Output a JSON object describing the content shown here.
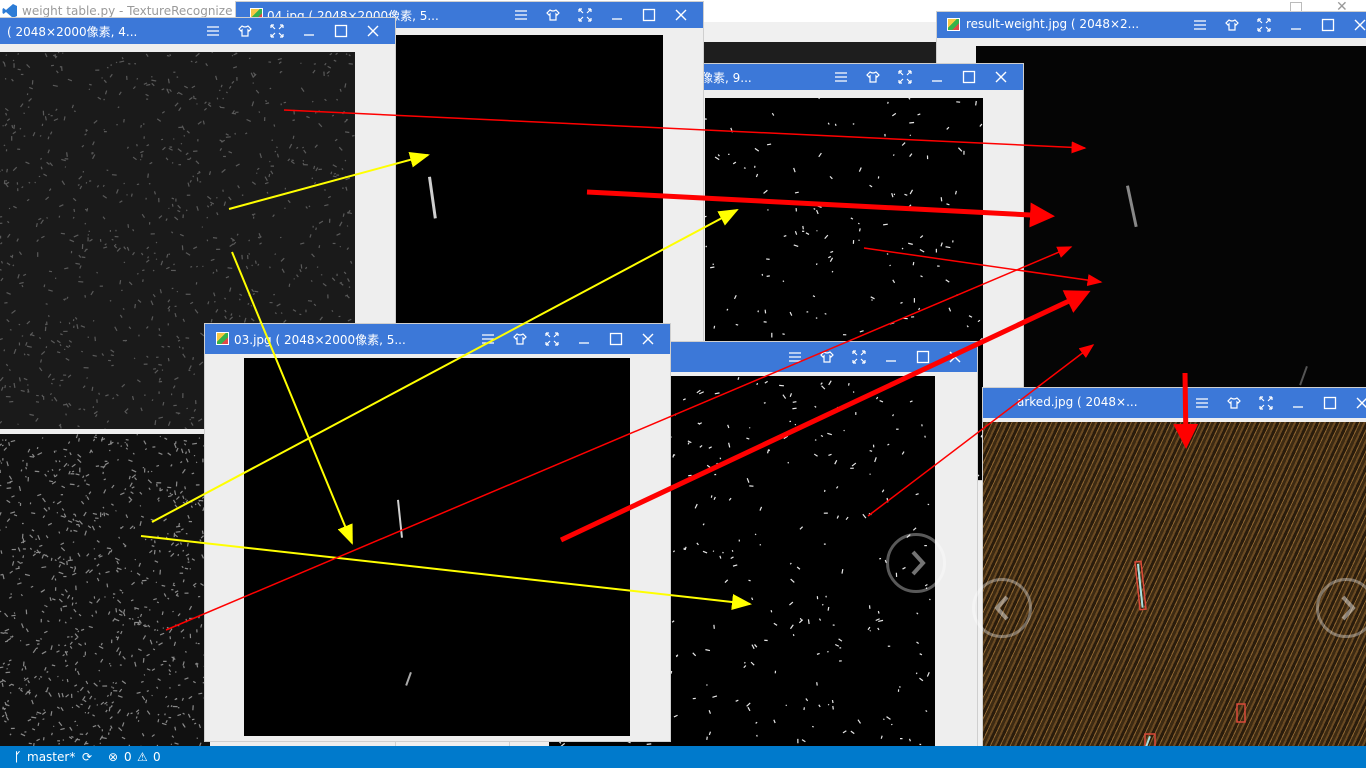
{
  "editor": {
    "title": "weight table.py - TextureRecognize -",
    "logo": "vscode-icon"
  },
  "windows": {
    "left": {
      "title": "( 2048×2000像素, 4..."
    },
    "w04": {
      "title": "04.jpg ( 2048×2000像素, 5..."
    },
    "w03": {
      "title": "03.jpg ( 2048×2000像素, 5..."
    },
    "mid": {
      "title": "像素, 9..."
    },
    "result": {
      "title": "result-weight.jpg ( 2048×2..."
    },
    "marked": {
      "title": "arked.jpg ( 2048×..."
    }
  },
  "window_icons": [
    "menu-icon",
    "skin-icon",
    "fullscreen-icon",
    "minimize-icon",
    "maximize-icon",
    "close-icon"
  ],
  "status_bar": {
    "branch": "master*",
    "errors": "0",
    "warnings": "0"
  },
  "colors": {
    "titlebar": "#3c78d8",
    "status": "#007acc",
    "arrow_yellow": "#ffff00",
    "arrow_red": "#ff0000"
  }
}
